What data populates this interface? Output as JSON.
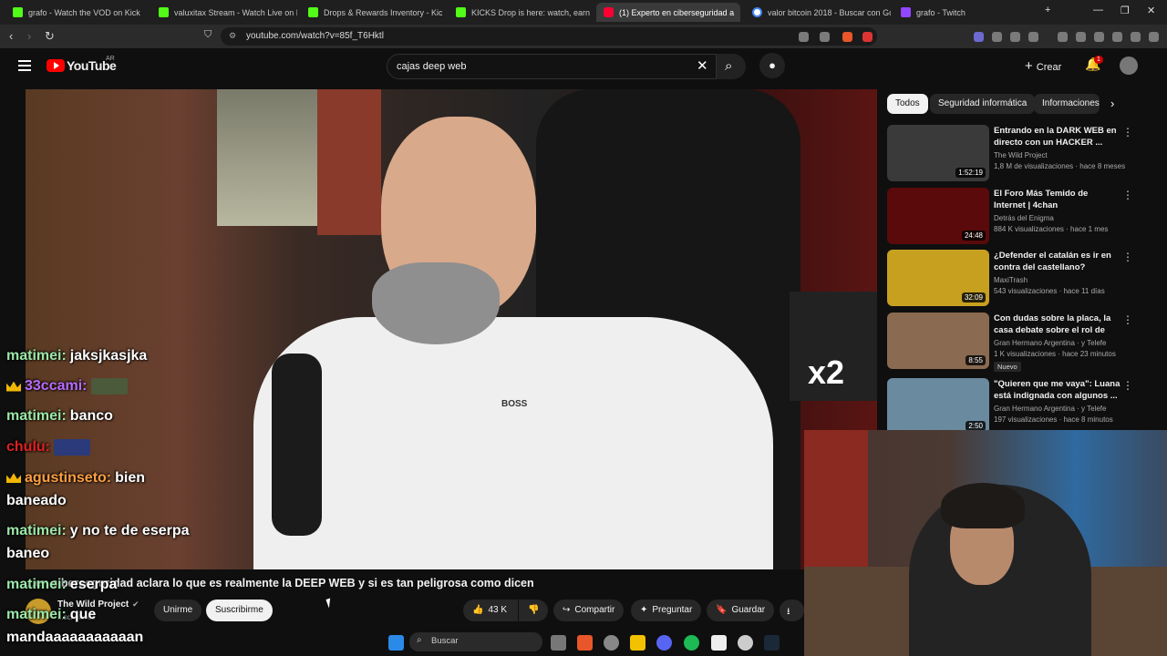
{
  "browser": {
    "tabs": [
      {
        "title": "grafo - Watch the VOD on Kick",
        "icon": "kick-icon"
      },
      {
        "title": "valuxitax Stream - Watch Live on Kick",
        "icon": "kick-icon"
      },
      {
        "title": "Drops & Rewards Inventory - Kick St",
        "icon": "kick-icon"
      },
      {
        "title": "KICKS Drop is here: watch, earn entr",
        "icon": "kick-icon"
      },
      {
        "title": "(1) Experto en ciberseguridad a",
        "icon": "youtube-icon",
        "active": true
      },
      {
        "title": "valor bitcoin 2018 - Buscar con Goo",
        "icon": "google-icon"
      },
      {
        "title": "grafo - Twitch",
        "icon": "twitch-icon"
      }
    ],
    "url": "youtube.com/watch?v=85f_T6Hktl"
  },
  "youtube": {
    "logo_text": "YouTube",
    "country": "AR",
    "search_value": "cajas deep web",
    "create_label": "Crear",
    "notification_count": "1",
    "video_title": "...en ciberseguridad aclara lo que es realmente la DEEP WEB y si es tan peligrosa como dicen",
    "channel": {
      "name": "The Wild Project",
      "subs": "...scriptores"
    },
    "buttons": {
      "join": "Unirme",
      "subscribe": "Suscribirme",
      "likes": "43 K",
      "share": "Compartir",
      "ask": "Preguntar",
      "save": "Guardar"
    },
    "video_overlay_text": {
      "brand": "BOSS",
      "sticker": "x2"
    }
  },
  "sidebar": {
    "chips": [
      "Todos",
      "Seguridad informática",
      "Informaciones"
    ],
    "recommendations": [
      {
        "title": "Entrando en la DARK WEB en directo con un HACKER ...",
        "channel": "The Wild Project",
        "meta": "1,8 M de visualizaciones · hace 8 meses",
        "duration": "1:52:19",
        "thumb_color": "#3a3a3a"
      },
      {
        "title": "El Foro Más Temido de Internet | 4chan",
        "channel": "Detrás del Enigma",
        "meta": "884 K visualizaciones · hace 1 mes",
        "duration": "24:48",
        "thumb_color": "#5a0a0a"
      },
      {
        "title": "¿Defender el catalán es ir en contra del castellano? Análisis...",
        "channel": "MaxiTrash",
        "meta": "543 visualizaciones · hace 11 días",
        "duration": "32:09",
        "thumb_color": "#c8a020"
      },
      {
        "title": "Con dudas sobre la placa, la casa debate sobre el rol de líd...",
        "channel": "Gran Hermano Argentina · y Telefe",
        "meta": "1 K visualizaciones · hace 23 minutos",
        "duration": "8:55",
        "badge": "Nuevo",
        "thumb_color": "#8a6a50"
      },
      {
        "title": "\"Quieren que me vaya\": Luana está indignada con algunos ...",
        "channel": "Gran Hermano Argentina · y Telefe",
        "meta": "197 visualizaciones · hace 8 minutos",
        "duration": "2:50",
        "thumb_color": "#6a8aa0"
      }
    ]
  },
  "chat": [
    {
      "user": "matimei:",
      "msg": "jaksjkasjka",
      "color": "#9be7a8"
    },
    {
      "user": "33ccami:",
      "msg": "",
      "color": "#b76cff",
      "crown": true,
      "emote": true
    },
    {
      "user": "matimei:",
      "msg": "banco",
      "color": "#9be7a8"
    },
    {
      "user": "chulu:",
      "msg": "",
      "color": "#e02020",
      "emote2": true
    },
    {
      "user": "agustinseto:",
      "msg": "bien",
      "color": "#ff9f40",
      "crown": true
    },
    {
      "user": "",
      "msg": "baneado",
      "color": "#fff"
    },
    {
      "user": "matimei:",
      "msg": "y no te de eserpa",
      "color": "#9be7a8"
    },
    {
      "user": "",
      "msg": "baneo",
      "color": "#fff"
    },
    {
      "user": "matimei:",
      "msg": "eserpa",
      "color": "#9be7a8"
    },
    {
      "user": "matimei:",
      "msg": "que",
      "color": "#9be7a8"
    },
    {
      "user": "",
      "msg": "mandaaaaaaaaaaan",
      "color": "#fff"
    }
  ],
  "taskbar": {
    "search_placeholder": "Buscar"
  }
}
